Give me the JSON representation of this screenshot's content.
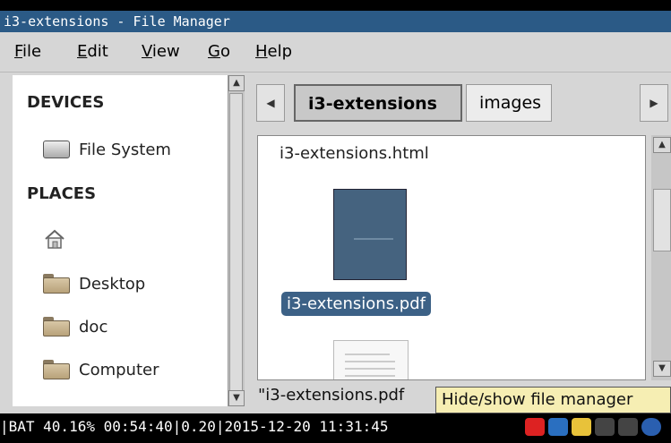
{
  "window": {
    "title": "i3-extensions - File Manager"
  },
  "menu": [
    {
      "prefix": "",
      "u": "F",
      "rest": "ile"
    },
    {
      "prefix": "",
      "u": "E",
      "rest": "dit"
    },
    {
      "prefix": "",
      "u": "V",
      "rest": "iew"
    },
    {
      "prefix": "",
      "u": "G",
      "rest": "o"
    },
    {
      "prefix": "",
      "u": "H",
      "rest": "elp"
    }
  ],
  "sidebar": {
    "devices_heading": "DEVICES",
    "places_heading": "PLACES",
    "items": [
      {
        "label": "File System",
        "icon": "drive-icon"
      },
      {
        "label": "",
        "icon": "home-icon"
      },
      {
        "label": "Desktop",
        "icon": "desktop-folder-icon"
      },
      {
        "label": "doc",
        "icon": "folder-icon"
      },
      {
        "label": "Computer",
        "icon": "folder-icon"
      }
    ]
  },
  "pathbar": {
    "crumbs": [
      {
        "label": "i3-extensions",
        "active": true
      },
      {
        "label": "images",
        "active": false
      }
    ]
  },
  "files": {
    "html_name": "i3-extensions.html",
    "pdf_name": "i3-extensions.pdf"
  },
  "statusbar": {
    "text": "\"i3-extensions.pdf"
  },
  "tooltip": {
    "text": "Hide/show file manager"
  },
  "i3bar": {
    "text": "|BAT 40.16% 00:54:40|0.20|2015-12-20 11:31:45"
  },
  "colors": {
    "titlebar": "#2b5a86",
    "selection": "#3c6186",
    "tooltip_bg": "#f6eeb3"
  }
}
